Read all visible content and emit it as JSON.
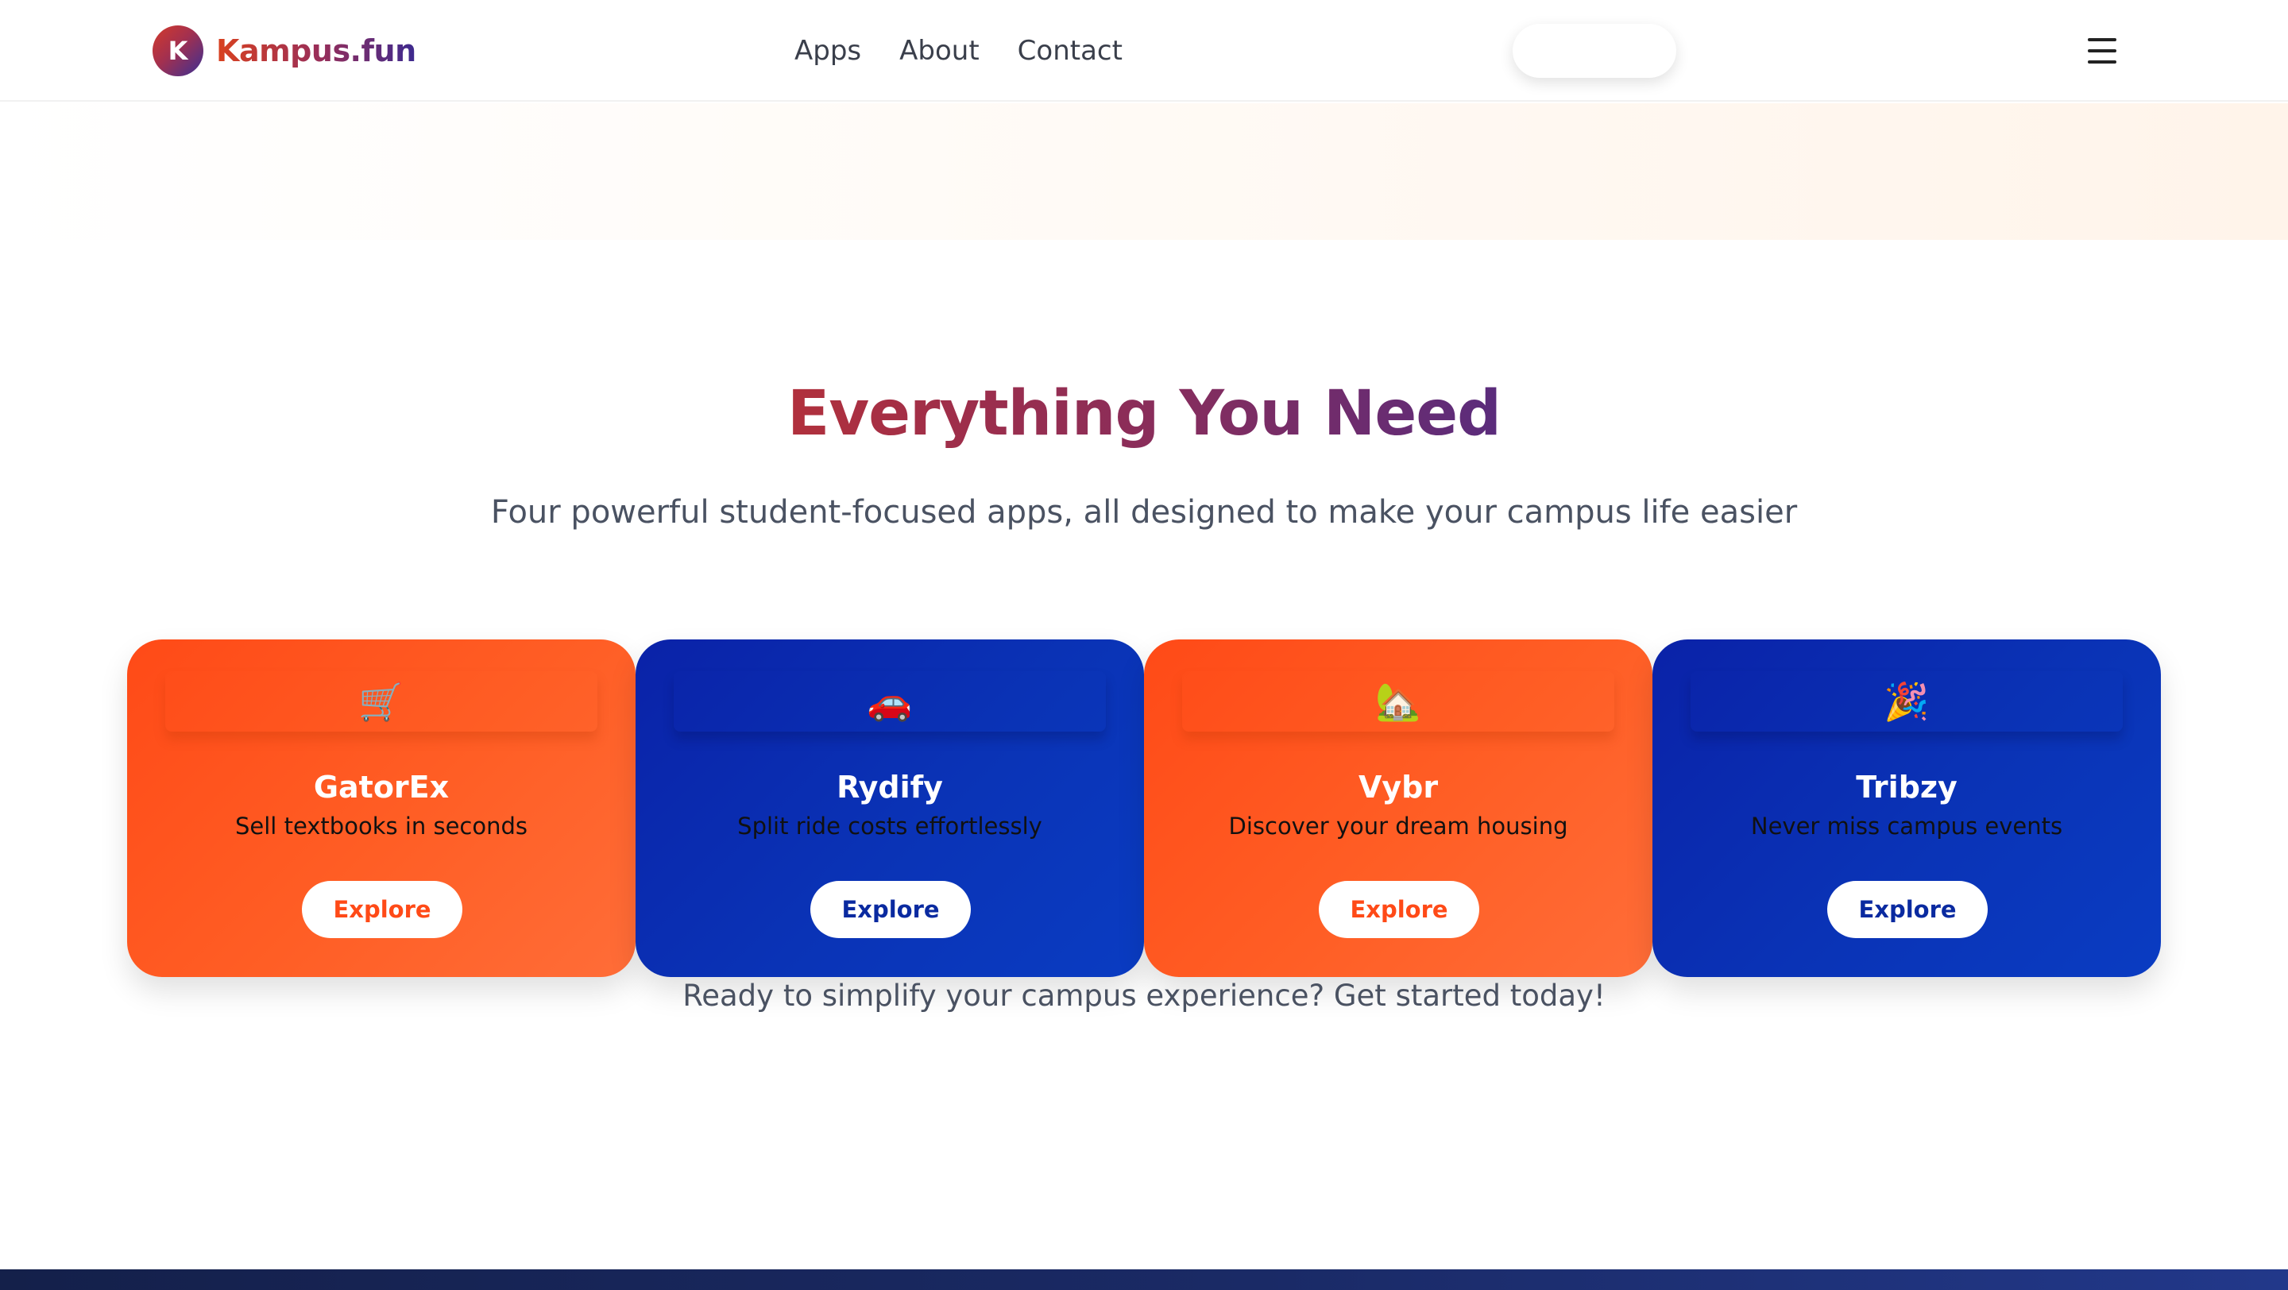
{
  "header": {
    "logo_letter": "K",
    "brand": "Kampus.fun",
    "nav": [
      {
        "label": "Apps"
      },
      {
        "label": "About"
      },
      {
        "label": "Contact"
      }
    ],
    "cta_label": ""
  },
  "section": {
    "title": "Everything You Need",
    "subtitle": "Four powerful student-focused apps, all designed to make your campus life easier"
  },
  "cards": [
    {
      "icon": "🛒",
      "icon_name": "shopping-cart-icon",
      "title": "GatorEx",
      "desc": "Sell textbooks in seconds",
      "button": "Explore",
      "theme": "orange",
      "accent": "#ff4a17"
    },
    {
      "icon": "🚗",
      "icon_name": "car-icon",
      "title": "Rydify",
      "desc": "Split ride costs effortlessly",
      "button": "Explore",
      "theme": "blue",
      "accent": "#0a2aa0"
    },
    {
      "icon": "🏡",
      "icon_name": "house-icon",
      "title": "Vybr",
      "desc": "Discover your dream housing",
      "button": "Explore",
      "theme": "orange",
      "accent": "#ff4a17"
    },
    {
      "icon": "🎉",
      "icon_name": "party-popper-icon",
      "title": "Tribzy",
      "desc": "Never miss campus events",
      "button": "Explore",
      "theme": "blue",
      "accent": "#0a2aa0"
    }
  ],
  "cta_text": "Ready to simplify your campus experience? Get started today!",
  "colors": {
    "orange": "#ff4a17",
    "blue": "#0a2aa0",
    "text_muted": "#4a5262",
    "footer": "#14204a"
  }
}
